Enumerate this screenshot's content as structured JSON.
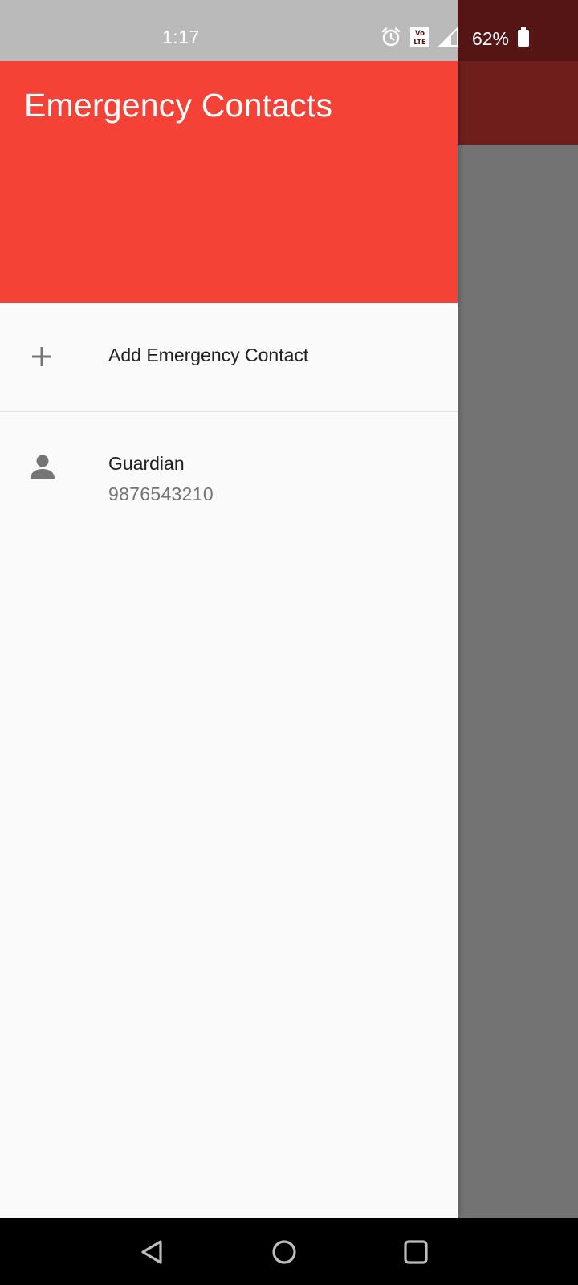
{
  "status_bar": {
    "time": "1:17",
    "battery_percent": "62%",
    "battery_level": 0.62,
    "icons": [
      "alarm-icon",
      "volte-icon",
      "signal-icon",
      "battery-icon"
    ]
  },
  "drawer": {
    "title": "Emergency Contacts",
    "header_color": "#f44336",
    "add_item": {
      "label": "Add Emergency Contact",
      "icon": "plus-icon"
    },
    "contacts": [
      {
        "name": "Guardian",
        "phone": "9876543210",
        "icon": "person-icon"
      }
    ]
  },
  "nav_bar": {
    "buttons": [
      "back-icon",
      "home-icon",
      "recents-icon"
    ]
  },
  "background_app": {
    "status_color": "#561515",
    "appbar_color": "#6e1f1b",
    "scrim_color": "#737373"
  }
}
